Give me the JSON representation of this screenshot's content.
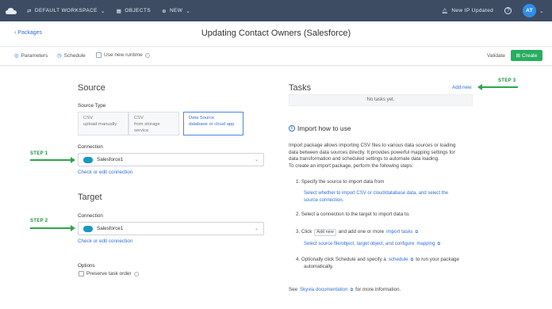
{
  "topbar": {
    "workspace": "DEFAULT WORKSPACE",
    "objects": "OBJECTS",
    "new": "NEW",
    "notification": "New IP Updated",
    "help": "?",
    "avatar_initials": "AT"
  },
  "header": {
    "back": "Packages",
    "title": "Updating Contact Owners (Salesforce)"
  },
  "toolbar": {
    "parameters": "Parameters",
    "schedule": "Schedule",
    "new_runtime": "Use new runtime",
    "validate": "Validate",
    "create": "Create"
  },
  "source": {
    "heading": "Source",
    "type_label": "Source Type",
    "types": [
      {
        "title": "CSV",
        "sub": "upload manually"
      },
      {
        "title": "CSV",
        "sub": "from storage service"
      },
      {
        "title": "Data Source",
        "sub": "database or cloud app"
      }
    ],
    "connection_label": "Connection",
    "connection_value": "Salesforce1",
    "connection_link": "Check or edit connection"
  },
  "target": {
    "heading": "Target",
    "connection_label": "Connection",
    "connection_value": "Salesforce1",
    "connection_link": "Check or edit connection"
  },
  "options": {
    "heading": "Options",
    "preserve": "Preserve task order"
  },
  "steps": {
    "s1": "STEP 1",
    "s2": "STEP 2",
    "s3": "STEP 3"
  },
  "tasks": {
    "heading": "Tasks",
    "add_new": "Add new",
    "empty": "No tasks yet."
  },
  "import_help": {
    "heading": "Import how to use",
    "intro": [
      "Import package allows importing CSV files to various data sources or loading",
      "data between data sources directly. It provides powerful mapping settings for",
      "data transformation and scheduled settings to automate data loading.",
      "To create an import package, perform the following steps:"
    ],
    "step1": "1. Specify the source to import data from",
    "step1_sub1": "Select whether to import CSV or cloud/database data, and select the",
    "step1_sub2": "source connection.",
    "step2": "2. Select a connection to the target to import data to.",
    "step3_pre": "3. Click",
    "step3_pill": "Add new",
    "step3_mid": "and add one or more",
    "step3_link": "import tasks",
    "step3_sub_pre": "Select source file/object, target object, and configure",
    "step3_sub_link": "mapping",
    "step4_pre": "4. Optionally click Schedule and specify a",
    "step4_link": "schedule",
    "step4_post": "to run your package",
    "step4_line2": "automatically.",
    "see_pre": "See",
    "see_link": "Skyvia documentation",
    "see_post": "for more information."
  }
}
